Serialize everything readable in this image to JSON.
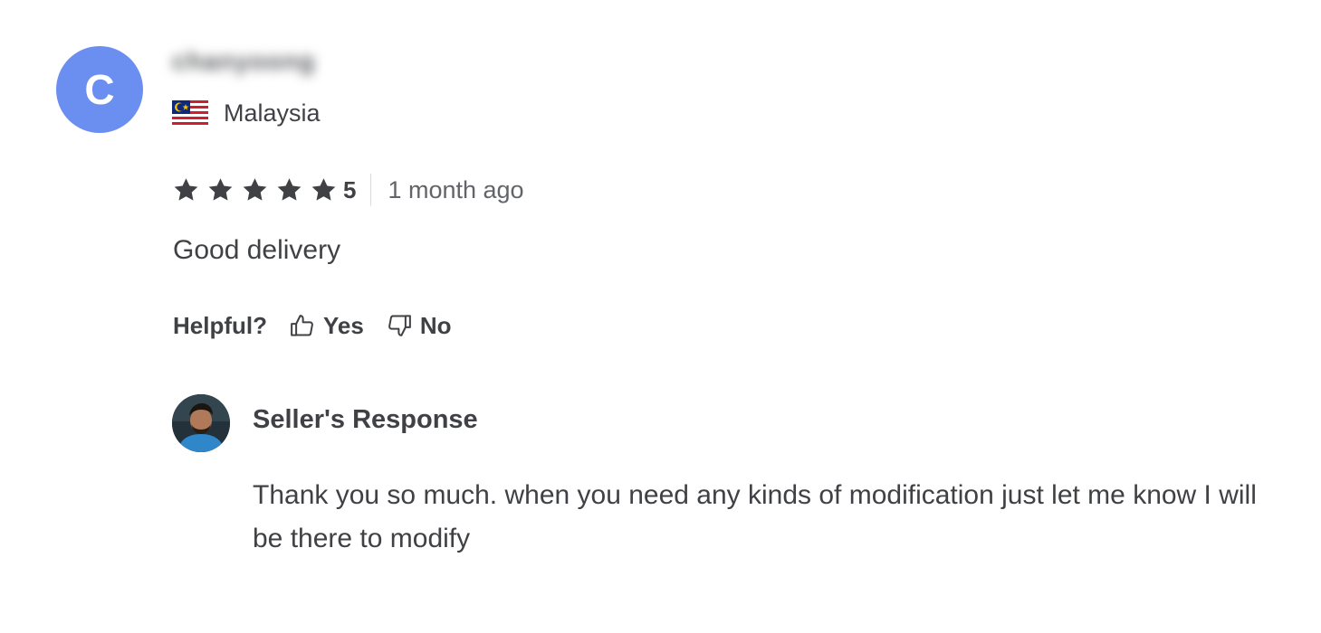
{
  "review": {
    "avatar_initial": "C",
    "username": "chanyoong",
    "country": "Malaysia",
    "rating": "5",
    "time_ago": "1 month ago",
    "text": "Good delivery",
    "helpful": {
      "label": "Helpful?",
      "yes_label": "Yes",
      "no_label": "No"
    },
    "seller_response": {
      "title": "Seller's Response",
      "text": "Thank you so much. when you need any kinds of modification just let me know I will be there to modify"
    }
  },
  "colors": {
    "avatar_bg": "#6b8ff0",
    "text": "#404145",
    "muted": "#62646a",
    "star": "#404145"
  },
  "icons": [
    "malaysia-flag-icon",
    "star-icon",
    "thumbs-up-icon",
    "thumbs-down-icon"
  ]
}
